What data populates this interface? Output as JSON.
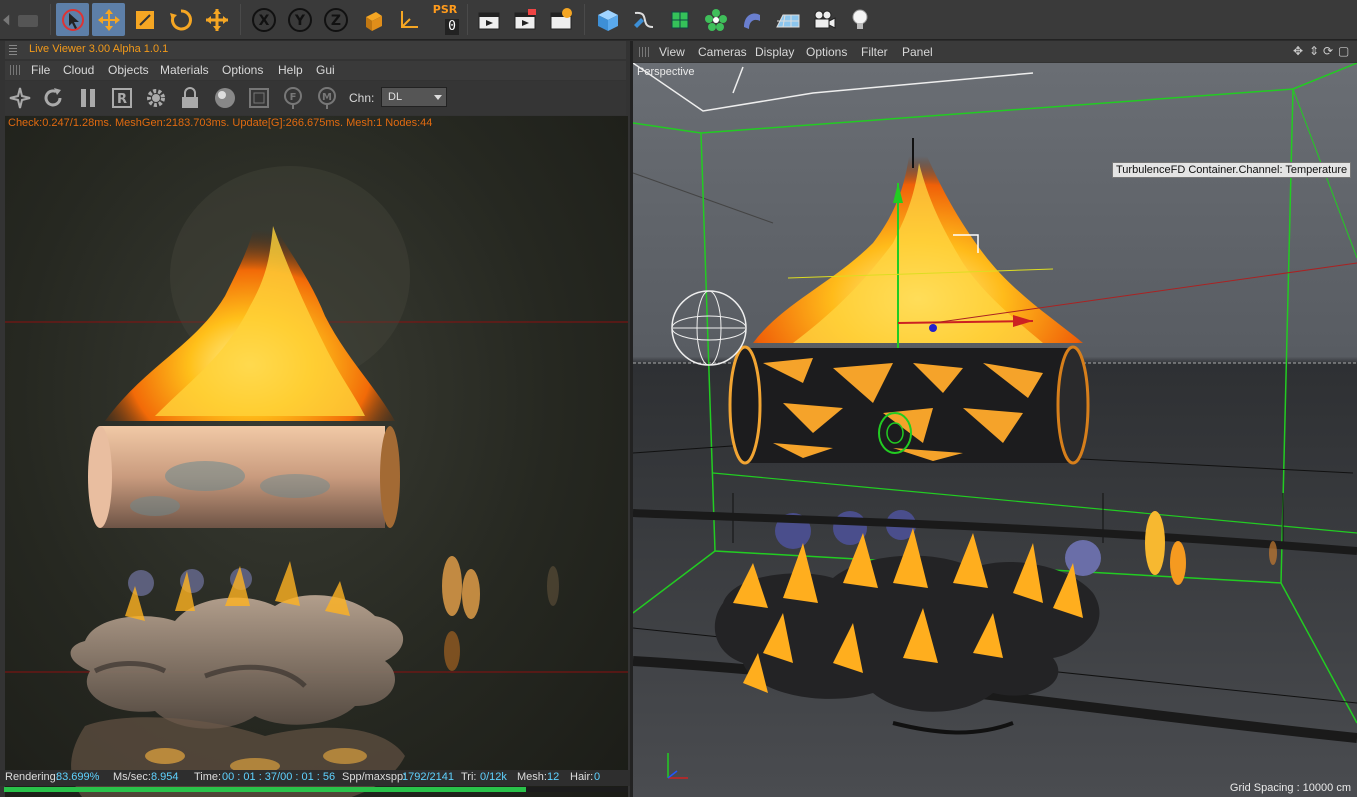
{
  "toolbar": {
    "psr_label": "PSR",
    "psr_value": "0",
    "axis_x": "X",
    "axis_y": "Y",
    "axis_z": "Z"
  },
  "live_viewer": {
    "title": "Live Viewer 3.00 Alpha 1.0.1",
    "menu": [
      "File",
      "Cloud",
      "Objects",
      "Materials",
      "Options",
      "Help",
      "Gui"
    ],
    "channel_label": "Chn:",
    "channel_value": "DL",
    "stats": "Check:0.247/1.28ms. MeshGen:2183.703ms. Update[G]:266.675ms. Mesh:1 Nodes:44",
    "status": {
      "rendering_label": "Rendering:",
      "rendering_value": "83.699%",
      "ms_label": "Ms/sec:",
      "ms_value": "8.954",
      "time_label": "Time:",
      "time_value": "00 : 01 : 37/00 : 01 : 56",
      "spp_label": "Spp/maxspp:",
      "spp_value": "1792/2141",
      "tri_label": "Tri:",
      "tri_value": "0/12k",
      "mesh_label": "Mesh:",
      "mesh_value": "12",
      "hair_label": "Hair:",
      "hair_value": "0"
    },
    "progress_fraction": 0.837
  },
  "viewport": {
    "menu": [
      "View",
      "Cameras",
      "Display",
      "Options",
      "Filter",
      "Panel"
    ],
    "projection": "Perspective",
    "tooltip": "TurbulenceFD Container.Channel: Temperature",
    "grid_spacing": "Grid Spacing : 10000 cm"
  },
  "colors": {
    "accent_orange": "#f29a1a",
    "active_blue": "#5d7fa8",
    "stats_orange": "#e06a10",
    "status_value": "#5fd2ff",
    "progress_green": "#29c24a",
    "container_green": "#22cc22"
  }
}
